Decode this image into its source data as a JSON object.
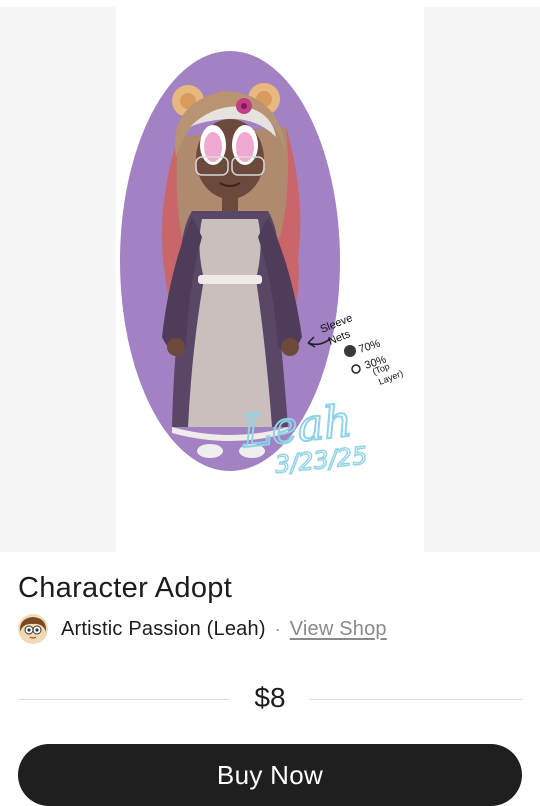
{
  "listing": {
    "title": "Character Adopt",
    "seller_name": "Artistic Passion (Leah)",
    "separator": "·",
    "view_shop_label": "View Shop",
    "price": "$8",
    "buy_label": "Buy Now"
  },
  "artwork": {
    "notes": [
      "Sleeve",
      "Nets",
      "70%",
      "30%",
      "(Top",
      "Layer)"
    ],
    "signature": "Leah",
    "date": "3/23/25"
  },
  "colors": {
    "button_bg": "#1f1f1f",
    "oval": "#a282c3",
    "signature": "#8fd3e6"
  },
  "icons": [
    "seller-avatar"
  ]
}
